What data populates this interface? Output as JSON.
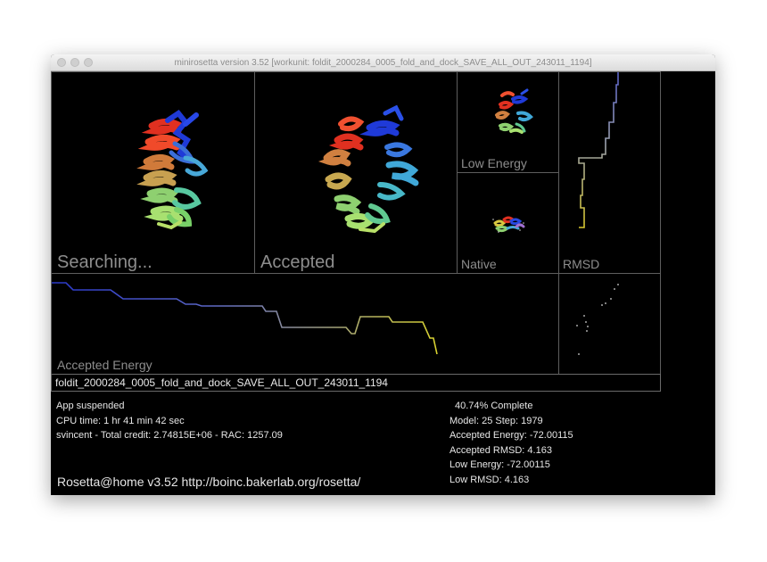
{
  "window": {
    "title": "minirosetta version 3.52 [workunit: foldit_2000284_0005_fold_and_dock_SAVE_ALL_OUT_243011_1194]"
  },
  "panels": {
    "searching": "Searching...",
    "accepted": "Accepted",
    "low_energy": "Low Energy",
    "native": "Native",
    "rmsd": "RMSD",
    "accepted_energy": "Accepted Energy"
  },
  "workunit_name": "foldit_2000284_0005_fold_and_dock_SAVE_ALL_OUT_243011_1194",
  "status": {
    "state": "App suspended",
    "cpu_time": "CPU time: 1 hr 41 min 42 sec",
    "credit": "svincent - Total credit: 2.74815E+06 - RAC: 1257.09"
  },
  "progress": {
    "complete": "40.74% Complete",
    "model_step": "Model: 25  Step: 1979",
    "accepted_energy": "Accepted Energy: -72.00115",
    "accepted_rmsd": "Accepted RMSD:  4.163",
    "low_energy": "Low Energy: -72.00115",
    "low_rmsd": "Low RMSD:  4.163"
  },
  "footer": "Rosetta@home v3.52 http://boinc.bakerlab.org/rosetta/",
  "colors": {
    "panel_border": "#5e5e5e",
    "label_gray": "#8d8d8d",
    "energy_line_start": "#2a38c8",
    "energy_line_end": "#d8d230",
    "rmsd_line_top": "#5a62c8",
    "rmsd_line_bottom": "#d8c830"
  },
  "icons": [
    "window-close-button",
    "window-minimize-button",
    "window-zoom-button"
  ]
}
